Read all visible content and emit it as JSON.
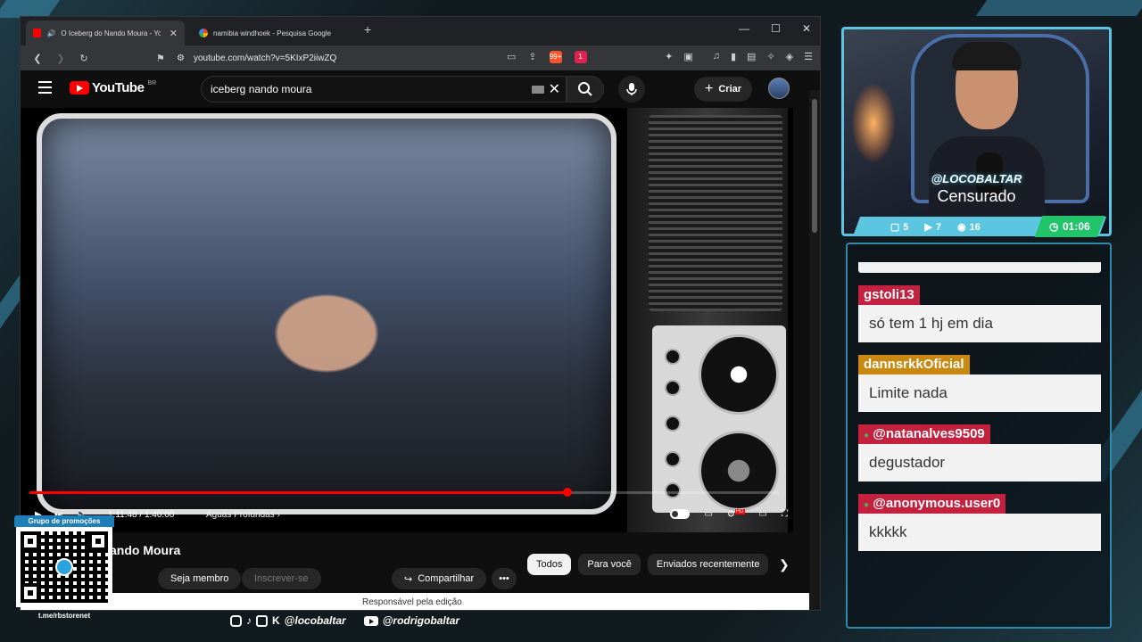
{
  "browser": {
    "tabs": [
      {
        "title": "O Iceberg do Nando Moura - YouT",
        "active": true
      },
      {
        "title": "namibia windhoek - Pesquisa Google",
        "active": false
      }
    ],
    "url": "youtube.com/watch?v=5KIxP2iiwZQ",
    "brave_badge": "99+",
    "alert_badge": "1"
  },
  "youtube": {
    "logo_text": "YouTube",
    "region": "BR",
    "search_query": "iceberg  nando moura",
    "create_label": "Criar"
  },
  "player": {
    "current_time": "1:11:48",
    "duration": "1:40:00",
    "time_display": "1:11:48 / 1:40:00",
    "chapter": "Águas Profundas",
    "progress": 0.718,
    "hd_badge": "HD"
  },
  "below_video": {
    "title_partial": "ando Moura",
    "member_label": "Seja membro",
    "subscribe_label": "Inscrever-se",
    "share_label": "Compartilhar",
    "chips": [
      "Todos",
      "Para você",
      "Enviados recentemente"
    ],
    "edit_notice": "Responsável pela edição"
  },
  "stream": {
    "handle": "@LOCOBALTAR",
    "status": "Censurado",
    "stats": [
      {
        "icon": "chat-icon",
        "value": "5"
      },
      {
        "icon": "youtube-icon",
        "value": "7"
      },
      {
        "icon": "viewers-icon",
        "value": "16"
      }
    ],
    "timer": "01:06"
  },
  "chat": {
    "messages": [
      {
        "user": "gstoli13",
        "text": "só tem 1 hj em dia",
        "color": "#c4213f"
      },
      {
        "user": "dannsrkkOficial",
        "text": "Limite nada",
        "color": "#c9880f"
      },
      {
        "user": "@natanalves9509",
        "text": "degustador",
        "color": "#c4213f"
      },
      {
        "user": "@anonymous.user0",
        "text": "kkkkk",
        "color": "#c4213f"
      }
    ]
  },
  "promo": {
    "title": "Grupo de promoções",
    "url": "t.me/rbstorenet"
  },
  "socials": [
    {
      "handle": "@locobaltar"
    },
    {
      "handle": "@rodrigobaltar"
    }
  ],
  "colors": {
    "accent": "#5cc6e0",
    "timer": "#22c46a",
    "yt_red": "#ff0000"
  }
}
